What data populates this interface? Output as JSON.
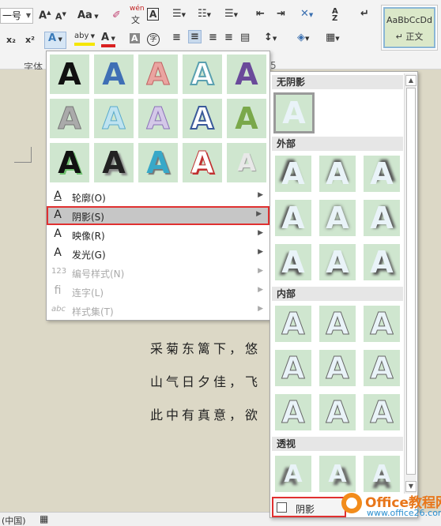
{
  "ribbon": {
    "font_size": "一号",
    "group_font": "字体",
    "group_marker": "5",
    "style_sample": "AaBbCcDd",
    "style_name": "↵ 正文",
    "wen_top": "wén",
    "wen_bottom": "文",
    "char_border": "A",
    "sort_icon": "A↓Z",
    "aa": "Aa",
    "aA": "A",
    "x2": "x₂",
    "x2sup": "x²",
    "abc": "aby",
    "char_shade": "A",
    "enclose": "字",
    "colors": {
      "highlight": "#f5e600",
      "font_red": "#d92020"
    }
  },
  "menu": {
    "items": [
      {
        "label": "轮廓(O)",
        "icon": "A",
        "arrow": "▶"
      },
      {
        "label": "阴影(S)",
        "icon": "A",
        "arrow": "▶"
      },
      {
        "label": "映像(R)",
        "icon": "A",
        "arrow": "▶"
      },
      {
        "label": "发光(G)",
        "icon": "A",
        "arrow": "▶"
      },
      {
        "label": "编号样式(N)",
        "icon": "123",
        "arrow": "▶"
      },
      {
        "label": "连字(L)",
        "icon": "fi",
        "arrow": "▶"
      },
      {
        "label": "样式集(T)",
        "icon": "abc",
        "arrow": "▶"
      }
    ],
    "tile_glyph": "A"
  },
  "shadow_submenu": {
    "sections": [
      "无阴影",
      "外部",
      "内部",
      "透视"
    ],
    "option_label": "阴影选项(S)...",
    "option_visible": "阴影",
    "glyph": "A"
  },
  "document": {
    "lines": [
      "采菊东篱下，悠",
      "山气日夕佳，飞",
      "此中有真意，欲"
    ]
  },
  "status": {
    "language": "(中国)"
  },
  "watermark": {
    "title": "Office教程网",
    "url": "www.office26.com"
  }
}
